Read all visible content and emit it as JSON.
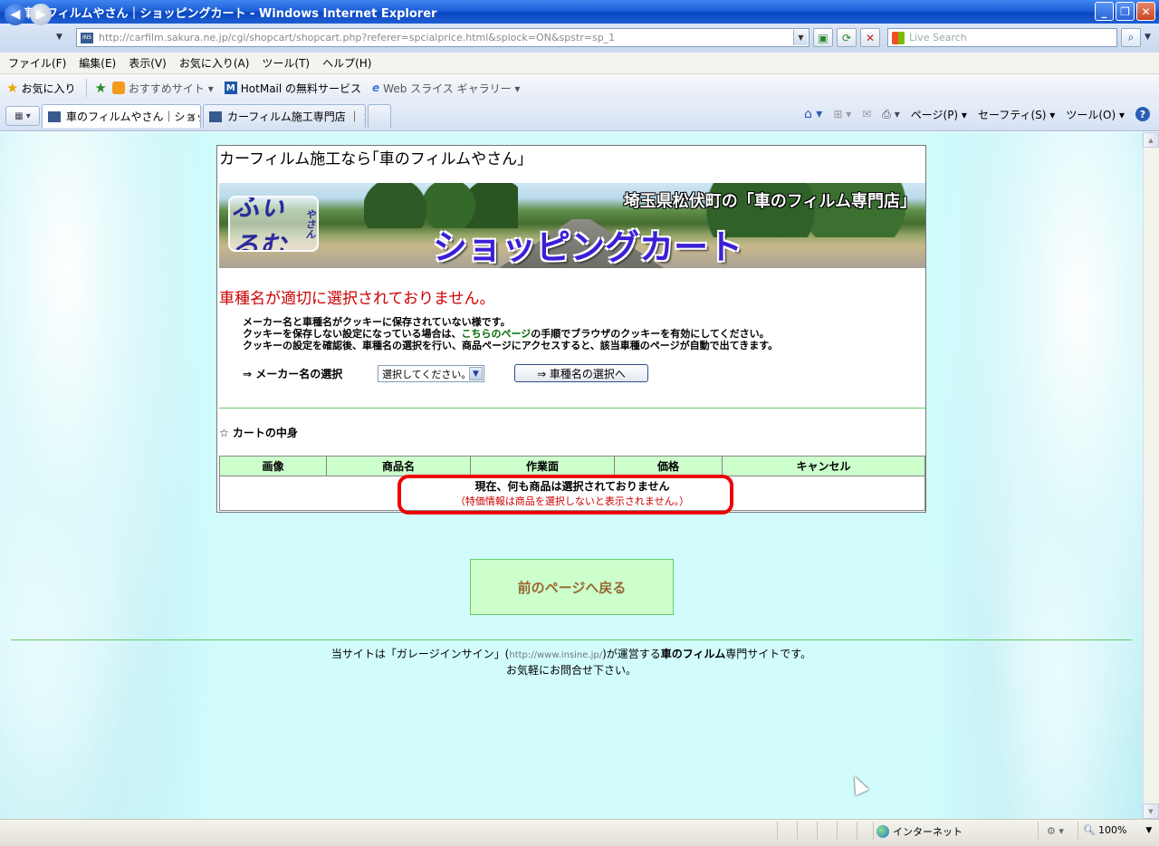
{
  "window": {
    "title": "車のフィルムやさん｜ショッピングカート - Windows Internet Explorer",
    "minimize": "_",
    "maximize": "❐",
    "close": "✕"
  },
  "address": {
    "url": "http://carfilm.sakura.ne.jp/cgi/shopcart/shopcart.php?referer=spcialprice.html&splock=ON&spstr=sp_1",
    "search_placeholder": "Live Search"
  },
  "menu": [
    "ファイル(F)",
    "編集(E)",
    "表示(V)",
    "お気に入り(A)",
    "ツール(T)",
    "ヘルプ(H)"
  ],
  "favorites": {
    "favorites_label": "お気に入り",
    "items": [
      "おすすめサイト ▾",
      "HotMail の無料サービス",
      "Web スライス ギャラリー ▾"
    ]
  },
  "tabs": [
    {
      "label": "車のフィルムやさん｜ショッ..."
    },
    {
      "label": "カーフィルム施工専門店 ｜ ガ..."
    }
  ],
  "commands": [
    "ページ(P) ▾",
    "セーフティ(S) ▾",
    "ツール(O) ▾"
  ],
  "page": {
    "site_title": "カーフィルム施工なら｢車のフィルムやさん｣",
    "banner": {
      "logo": "ふぃるむ",
      "logo_small": "やさん",
      "headline": "ショッピングカート",
      "shop_name": "埼玉県松伏町の「車のフィルム専門店」"
    },
    "error": "車種名が適切に選択されておりません。",
    "message": {
      "line1": "メーカー名と車種名がクッキーに保存されていない様です。",
      "line2_pre": "クッキーを保存しない設定になっている場合は、",
      "line2_link": "こちらのページ",
      "line2_post": "の手順でブラウザのクッキーを有効にしてください。",
      "line3": "クッキーの設定を確認後、車種名の選択を行い、商品ページにアクセスすると、該当車種のページが自動で出てきます。"
    },
    "maker_label": "⇒  メーカー名の選択",
    "maker_select": "選択してください。",
    "car_button": "⇒ 車種名の選択へ",
    "cart_heading": "☆  カートの中身",
    "cart_columns": [
      "画像",
      "商品名",
      "作業面",
      "価格",
      "キャンセル"
    ],
    "cart_empty": "現在、何も商品は選択されておりません",
    "cart_note": "（特価情報は商品を選択しないと表示されません。）",
    "back_button": "前のページへ戻る",
    "footer": {
      "pre": "当サイトは「ガレージインサイン」(",
      "url": "http://www.insine.jp/",
      "mid": ")が運営する",
      "strong": "車のフィルム",
      "post": "専門サイトです。",
      "line2": "お気軽にお問合せ下さい。"
    }
  },
  "status": {
    "zone": "インターネット",
    "zoom": "100%"
  }
}
